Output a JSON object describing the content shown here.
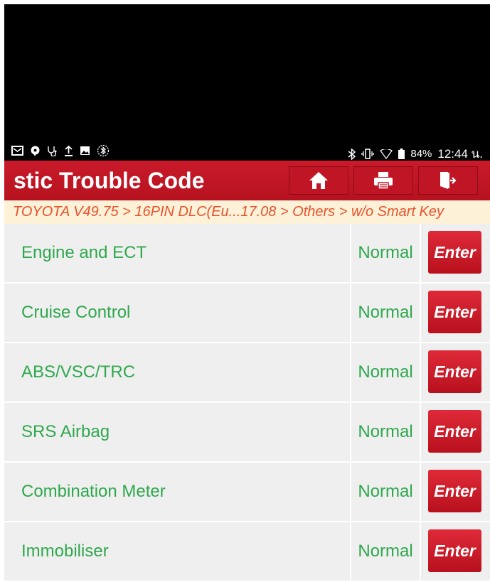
{
  "status_bar": {
    "battery": "84%",
    "time": "12:44 น."
  },
  "header": {
    "title": "stic Trouble Code"
  },
  "breadcrumb": "TOYOTA V49.75 > 16PIN DLC(Eu...17.08 > Others > w/o Smart Key",
  "systems": [
    {
      "name": "Engine and ECT",
      "status": "Normal",
      "action": "Enter"
    },
    {
      "name": "Cruise Control",
      "status": "Normal",
      "action": "Enter"
    },
    {
      "name": "ABS/VSC/TRC",
      "status": "Normal",
      "action": "Enter"
    },
    {
      "name": "SRS Airbag",
      "status": "Normal",
      "action": "Enter"
    },
    {
      "name": "Combination Meter",
      "status": "Normal",
      "action": "Enter"
    },
    {
      "name": "Immobiliser",
      "status": "Normal",
      "action": "Enter"
    }
  ],
  "colors": {
    "header_red": "#c01524",
    "text_green": "#2ea84d",
    "breadcrumb_orange": "#e8522c",
    "breadcrumb_bg": "#fdf1d8"
  },
  "icons": [
    "mail-icon",
    "chat-icon",
    "stethoscope-icon",
    "upload-icon",
    "image-icon",
    "bluetooth-scan-icon",
    "bluetooth-icon",
    "vibrate-icon",
    "wifi-icon",
    "battery-icon",
    "home-icon",
    "print-icon",
    "exit-icon"
  ]
}
